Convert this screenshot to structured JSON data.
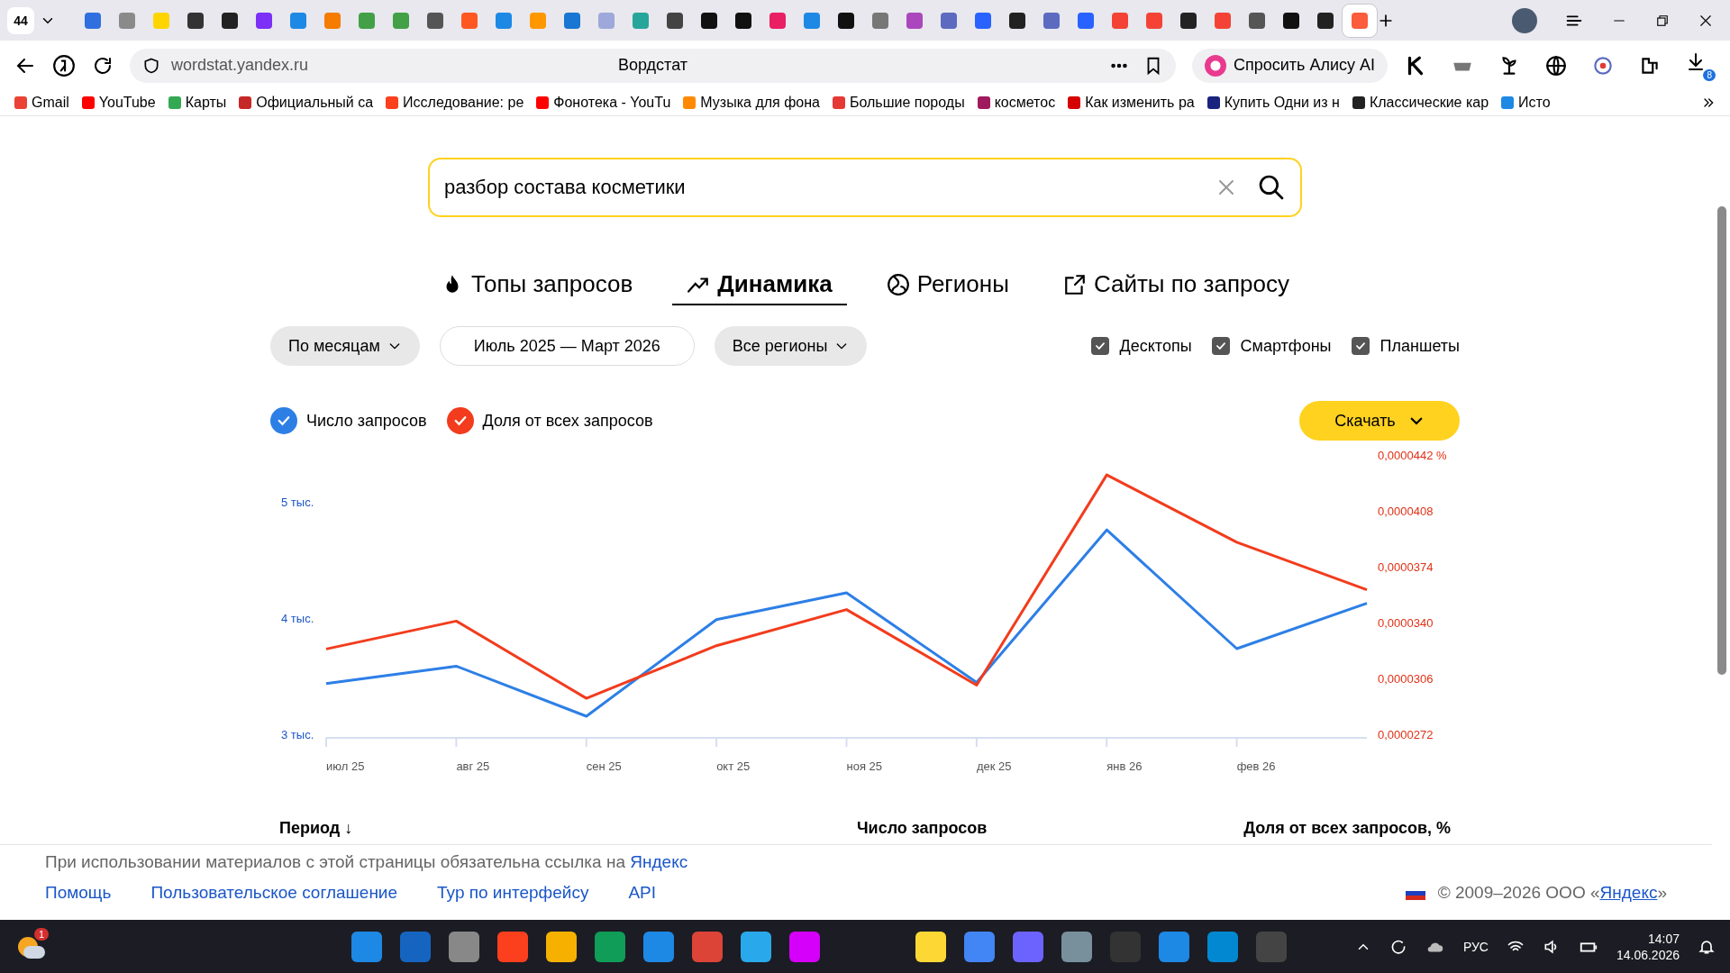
{
  "browser": {
    "tab_count": "44",
    "tabs": [
      {
        "selected": false
      },
      {
        "selected": false
      },
      {
        "selected": false
      },
      {
        "selected": false
      },
      {
        "selected": false
      },
      {
        "selected": false
      },
      {
        "selected": false
      },
      {
        "selected": false
      },
      {
        "selected": false
      },
      {
        "selected": false
      },
      {
        "selected": false
      },
      {
        "selected": false
      },
      {
        "selected": false
      },
      {
        "selected": false
      },
      {
        "selected": false
      },
      {
        "selected": false
      },
      {
        "selected": false
      },
      {
        "selected": false
      },
      {
        "selected": false
      },
      {
        "selected": false
      },
      {
        "selected": false
      },
      {
        "selected": false
      },
      {
        "selected": false
      },
      {
        "selected": false
      },
      {
        "selected": false
      },
      {
        "selected": false
      },
      {
        "selected": false
      },
      {
        "selected": false
      },
      {
        "selected": false
      },
      {
        "selected": false
      },
      {
        "selected": false
      },
      {
        "selected": false
      },
      {
        "selected": false
      },
      {
        "selected": false
      },
      {
        "selected": false
      },
      {
        "selected": false
      },
      {
        "selected": false
      },
      {
        "selected": true
      }
    ],
    "address": "wordstat.yandex.ru",
    "page_title": "Вордстат",
    "alice_button": "Спросить Алису AI",
    "downloads_badge": "8",
    "bookmarks": [
      {
        "label": "Gmail",
        "color": "#ea4335"
      },
      {
        "label": "YouTube",
        "color": "#ff0000"
      },
      {
        "label": "Карты",
        "color": "#34a853"
      },
      {
        "label": "Официальный са",
        "color": "#c62828"
      },
      {
        "label": "Исследование: ре",
        "color": "#fc3f1d"
      },
      {
        "label": "Фонотека - YouTu",
        "color": "#ff0000"
      },
      {
        "label": "Музыка для фона",
        "color": "#ff8a00"
      },
      {
        "label": "Большие породы",
        "color": "#e53935"
      },
      {
        "label": "косметос",
        "color": "#a01b5d"
      },
      {
        "label": "Как изменить ра",
        "color": "#d50000"
      },
      {
        "label": "Купить Одни из н",
        "color": "#1a237e"
      },
      {
        "label": "Классические кар",
        "color": "#222222"
      },
      {
        "label": "Исто",
        "color": "#1e88e5"
      }
    ]
  },
  "search": {
    "value": "разбор состава косметики"
  },
  "tabs": [
    {
      "label": "Топы запросов",
      "kind": "flame",
      "selected": false
    },
    {
      "label": "Динамика",
      "kind": "trend",
      "selected": true
    },
    {
      "label": "Регионы",
      "kind": "globe",
      "selected": false
    },
    {
      "label": "Сайты по запросу",
      "kind": "external",
      "selected": false
    }
  ],
  "filters": {
    "period": "По месяцам",
    "range": "Июль 2025 — Март 2026",
    "region": "Все регионы",
    "devices": [
      {
        "label": "Десктопы",
        "checked": true
      },
      {
        "label": "Смартфоны",
        "checked": true
      },
      {
        "label": "Планшеты",
        "checked": true
      }
    ]
  },
  "legend": [
    {
      "checked": true
    },
    {
      "checked": true
    }
  ],
  "download_button": "Скачать",
  "chart_data": {
    "type": "line",
    "categories": [
      "июл 25",
      "авг 25",
      "сен 25",
      "окт 25",
      "ноя 25",
      "дек 25",
      "янв 26",
      "фев 26",
      null
    ],
    "ylim": [
      3,
      5
    ],
    "yticks": [
      {
        "value": 3,
        "label": "3 тыс."
      },
      {
        "value": 4,
        "label": "4 тыс."
      },
      {
        "value": 5,
        "label": "5 тыс."
      }
    ],
    "y2lim": [
      2.72e-05,
      4.42e-05
    ],
    "y2ticks": [
      {
        "value": 2.72e-05,
        "label": "0,0000272"
      },
      {
        "value": 3.06e-05,
        "label": "0,0000306"
      },
      {
        "value": 3.4e-05,
        "label": "0,0000340"
      },
      {
        "value": 3.74e-05,
        "label": "0,0000374"
      },
      {
        "value": 4.08e-05,
        "label": "0,0000408"
      },
      {
        "value": 4.42e-05,
        "label": "0,0000442 %"
      }
    ],
    "series": [
      {
        "name": "Число запросов",
        "color": "#2d7fe6",
        "values": [
          3.45,
          3.6,
          3.17,
          4,
          4.23,
          3.46,
          4.77,
          3.75,
          4.14
        ]
      },
      {
        "name": "Доля от всех запросов",
        "color": "#f23c1d",
        "axis": "y2",
        "values": [
          3.25e-05,
          3.42e-05,
          2.95e-05,
          3.27e-05,
          3.49e-05,
          3.03e-05,
          4.31e-05,
          3.9e-05,
          3.61e-05
        ]
      }
    ]
  },
  "table": {
    "columns": [
      "Период ↓",
      "Число запросов",
      "Доля от всех запросов, %"
    ]
  },
  "footer": {
    "notice": {
      "text": "При использовании материалов с этой страницы обязательна ссылка на ",
      "link": "Яндекс"
    },
    "links": [
      "Помощь",
      "Пользовательское соглашение",
      "Тур по интерфейсу",
      "API"
    ],
    "copyright": {
      "before": "© 2009–2026 ООО «",
      "link": "Яндекс",
      "after": "»"
    }
  },
  "taskbar": {
    "weather_badge": "1",
    "language": "РУС",
    "time": "14:07",
    "date": "14.06.2026"
  }
}
